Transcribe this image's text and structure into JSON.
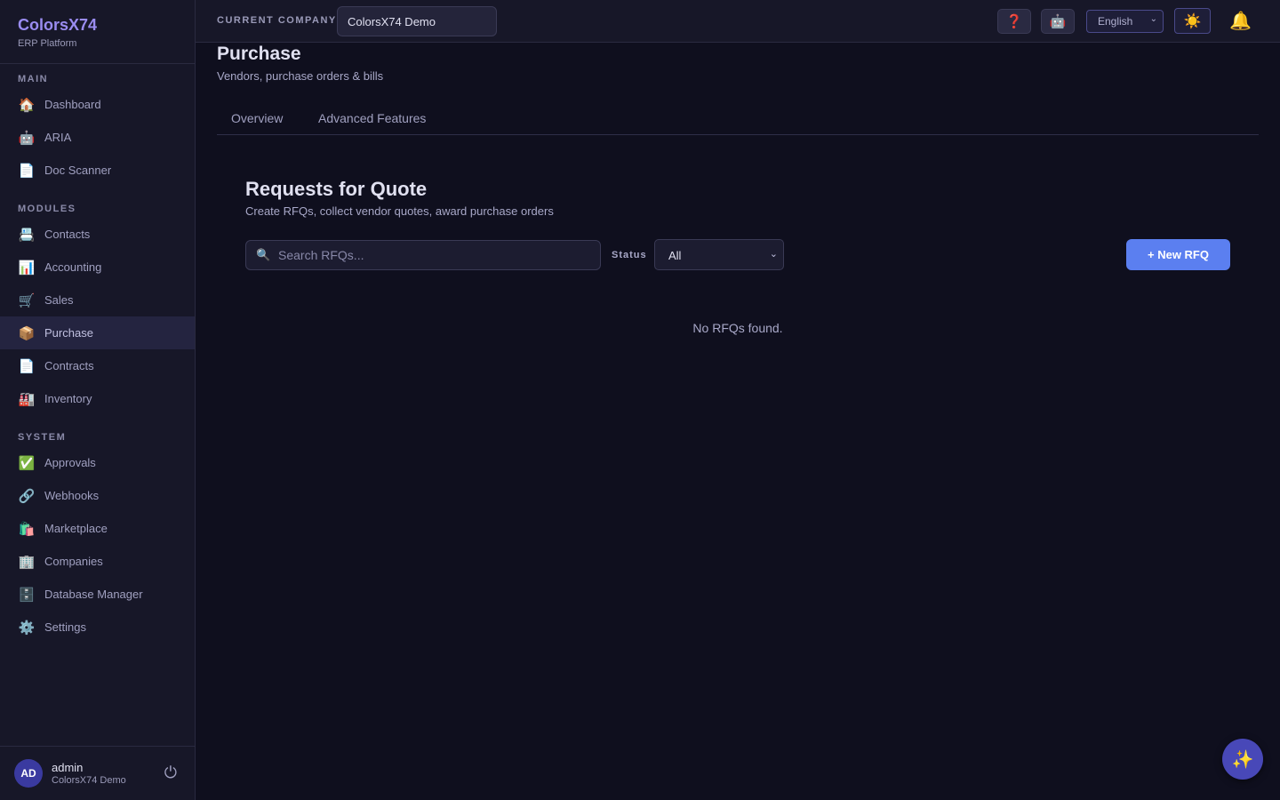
{
  "brand": {
    "name": "ColorsX74",
    "subtitle": "ERP Platform"
  },
  "sidebar": {
    "main_title": "MAIN",
    "main_items": [
      {
        "label": "Dashboard",
        "icon": "🏠"
      },
      {
        "label": "ARIA",
        "icon": "🤖"
      },
      {
        "label": "Doc Scanner",
        "icon": "📄"
      }
    ],
    "modules_title": "MODULES",
    "module_items": [
      {
        "label": "Contacts",
        "icon": "📇"
      },
      {
        "label": "Accounting",
        "icon": "📊"
      },
      {
        "label": "Sales",
        "icon": "🛒"
      },
      {
        "label": "Purchase",
        "icon": "📦",
        "active": true
      },
      {
        "label": "Contracts",
        "icon": "📄"
      },
      {
        "label": "Inventory",
        "icon": "🏭"
      }
    ],
    "system_title": "SYSTEM",
    "system_items": [
      {
        "label": "Approvals",
        "icon": "✅"
      },
      {
        "label": "Webhooks",
        "icon": "🔗"
      },
      {
        "label": "Marketplace",
        "icon": "🛍️"
      },
      {
        "label": "Companies",
        "icon": "🏢"
      },
      {
        "label": "Database Manager",
        "icon": "🗄️"
      },
      {
        "label": "Settings",
        "icon": "⚙️"
      }
    ]
  },
  "user": {
    "initials": "AD",
    "name": "admin",
    "company": "ColorsX74 Demo",
    "power_icon": "⏻"
  },
  "topbar": {
    "company_label": "CURRENT COMPANY",
    "company_value": "ColorsX74 Demo",
    "help_icon": "❓",
    "bot_icon": "🤖",
    "language": "English",
    "theme_icon": "☀️",
    "bell_icon": "🔔"
  },
  "page": {
    "title": "Purchase",
    "subtitle": "Vendors, purchase orders & bills",
    "tabs": [
      "Overview",
      "Advanced Features"
    ]
  },
  "rfq": {
    "title": "Requests for Quote",
    "subtitle": "Create RFQs, collect vendor quotes, award purchase orders",
    "search_icon": "🔍",
    "search_placeholder": "Search RFQs...",
    "status_label": "Status",
    "status_value": "All",
    "new_button": "+ New RFQ",
    "empty_text": "No RFQs found."
  },
  "fab_icon": "✨",
  "colors": {
    "accent": "#5b7ff0",
    "brand": "#9a8cf0",
    "background": "#0f0f1e",
    "sidebar": "#171728"
  }
}
